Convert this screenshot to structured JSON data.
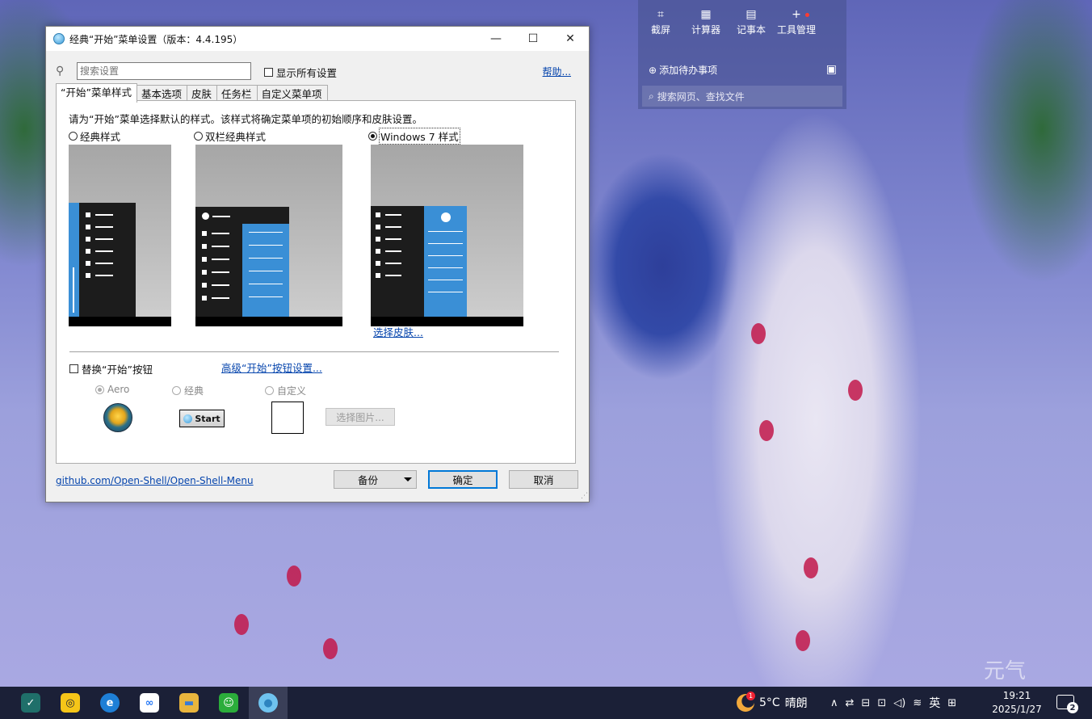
{
  "desktop": {
    "watermark": "元气"
  },
  "float_panel": {
    "tools": [
      {
        "icon": "crop-icon",
        "glyph": "⌗",
        "label": "截屏"
      },
      {
        "icon": "calculator-icon",
        "glyph": "▦",
        "label": "计算器"
      },
      {
        "icon": "notepad-icon",
        "glyph": "▤",
        "label": "记事本"
      },
      {
        "icon": "plus-icon",
        "glyph": "+",
        "label": "工具管理"
      }
    ],
    "todo_label": "添加待办事项",
    "todo_glyph": "⊕",
    "qr_glyph": "▣",
    "search_glyph": "⌕",
    "search_placeholder": "搜索网页、查找文件"
  },
  "dialog": {
    "title": "经典“开始”菜单设置（版本：4.4.195）",
    "controls": {
      "minimize": "—",
      "maximize": "☐",
      "close": "✕"
    },
    "search_glyph": "⚲",
    "search_placeholder": "搜索设置",
    "show_all_label": "显示所有设置",
    "help_link": "帮助...",
    "tabs": [
      "“开始”菜单样式",
      "基本选项",
      "皮肤",
      "任务栏",
      "自定义菜单项"
    ],
    "active_tab": 0,
    "description": "请为“开始”菜单选择默认的样式。该样式将确定菜单项的初始顺序和皮肤设置。",
    "styles": [
      {
        "label": "经典样式",
        "selected": false
      },
      {
        "label": "双栏经典样式",
        "selected": false
      },
      {
        "label": "Windows 7 样式",
        "selected": true
      }
    ],
    "select_skin_link": "选择皮肤...",
    "replace_start_label": "替换“开始”按钮",
    "replace_start_checked": false,
    "advanced_link": "高级“开始”按钮设置...",
    "button_styles": [
      {
        "label": "Aero",
        "selected": true
      },
      {
        "label": "经典",
        "selected": false
      },
      {
        "label": "自定义",
        "selected": false
      }
    ],
    "classic_button_text": "Start",
    "pick_image_label": "选择图片...",
    "footer_link": "github.com/Open-Shell/Open-Shell-Menu",
    "backup_label": "备份",
    "ok_label": "确定",
    "cancel_label": "取消",
    "accent_color": "#0078d7"
  },
  "taskbar": {
    "apps": [
      {
        "name": "app-1-icon",
        "glyph": "✓",
        "bg": "#1f6f6a"
      },
      {
        "name": "app-2-icon",
        "glyph": "◎",
        "bg": "#f5c518"
      },
      {
        "name": "edge-icon",
        "glyph": "e",
        "bg": "#1e7fd6"
      },
      {
        "name": "baidu-netdisk-icon",
        "glyph": "∞",
        "bg": "#ffffff"
      },
      {
        "name": "folder-icon",
        "glyph": "▬",
        "bg": "#e9b53d"
      },
      {
        "name": "wechat-icon",
        "glyph": "☺",
        "bg": "#2bad3b"
      },
      {
        "name": "open-shell-icon",
        "glyph": "●",
        "bg": "#6fc3ef"
      }
    ],
    "active_app": 6,
    "weather_badge": "1",
    "temperature": "5°C",
    "weather_text": "晴朗",
    "tray_glyphs": [
      "∧",
      "⇄",
      "⊟",
      "⊡",
      "◁)",
      "≋",
      "英",
      "⊞"
    ],
    "time": "19:21",
    "date": "2025/1/27",
    "notification_count": "2"
  }
}
